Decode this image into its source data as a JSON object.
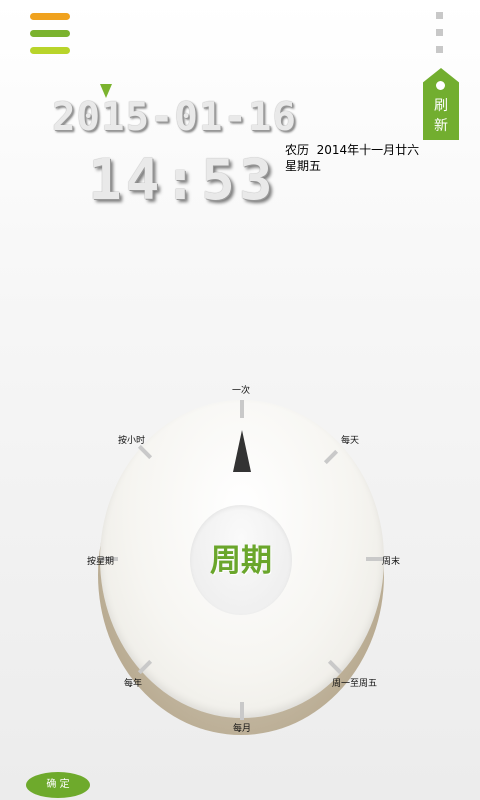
{
  "header": {
    "menu_icon": "hamburger-menu-icon",
    "more_icon": "more-vertical-icon",
    "menu_colors": [
      "#f0a21e",
      "#7bb32e",
      "#b8d42a"
    ]
  },
  "datetime": {
    "date": "2015-01-16",
    "time": "14:53",
    "lunar": "农历  2014年十一月廿六",
    "weekday": "星期五"
  },
  "refresh": {
    "label_line1": "刷",
    "label_line2": "新"
  },
  "dial": {
    "center_label": "周期",
    "labels": {
      "once": "一次",
      "daily": "每天",
      "weekend": "周末",
      "weekdays": "周一至周五",
      "monthly": "每月",
      "yearly": "每年",
      "by_week": "按星期",
      "by_hour": "按小时"
    },
    "selected": "一次"
  },
  "footer": {
    "confirm_label": "确 定"
  },
  "colors": {
    "accent": "#72ae2f",
    "needle": "#333333"
  }
}
